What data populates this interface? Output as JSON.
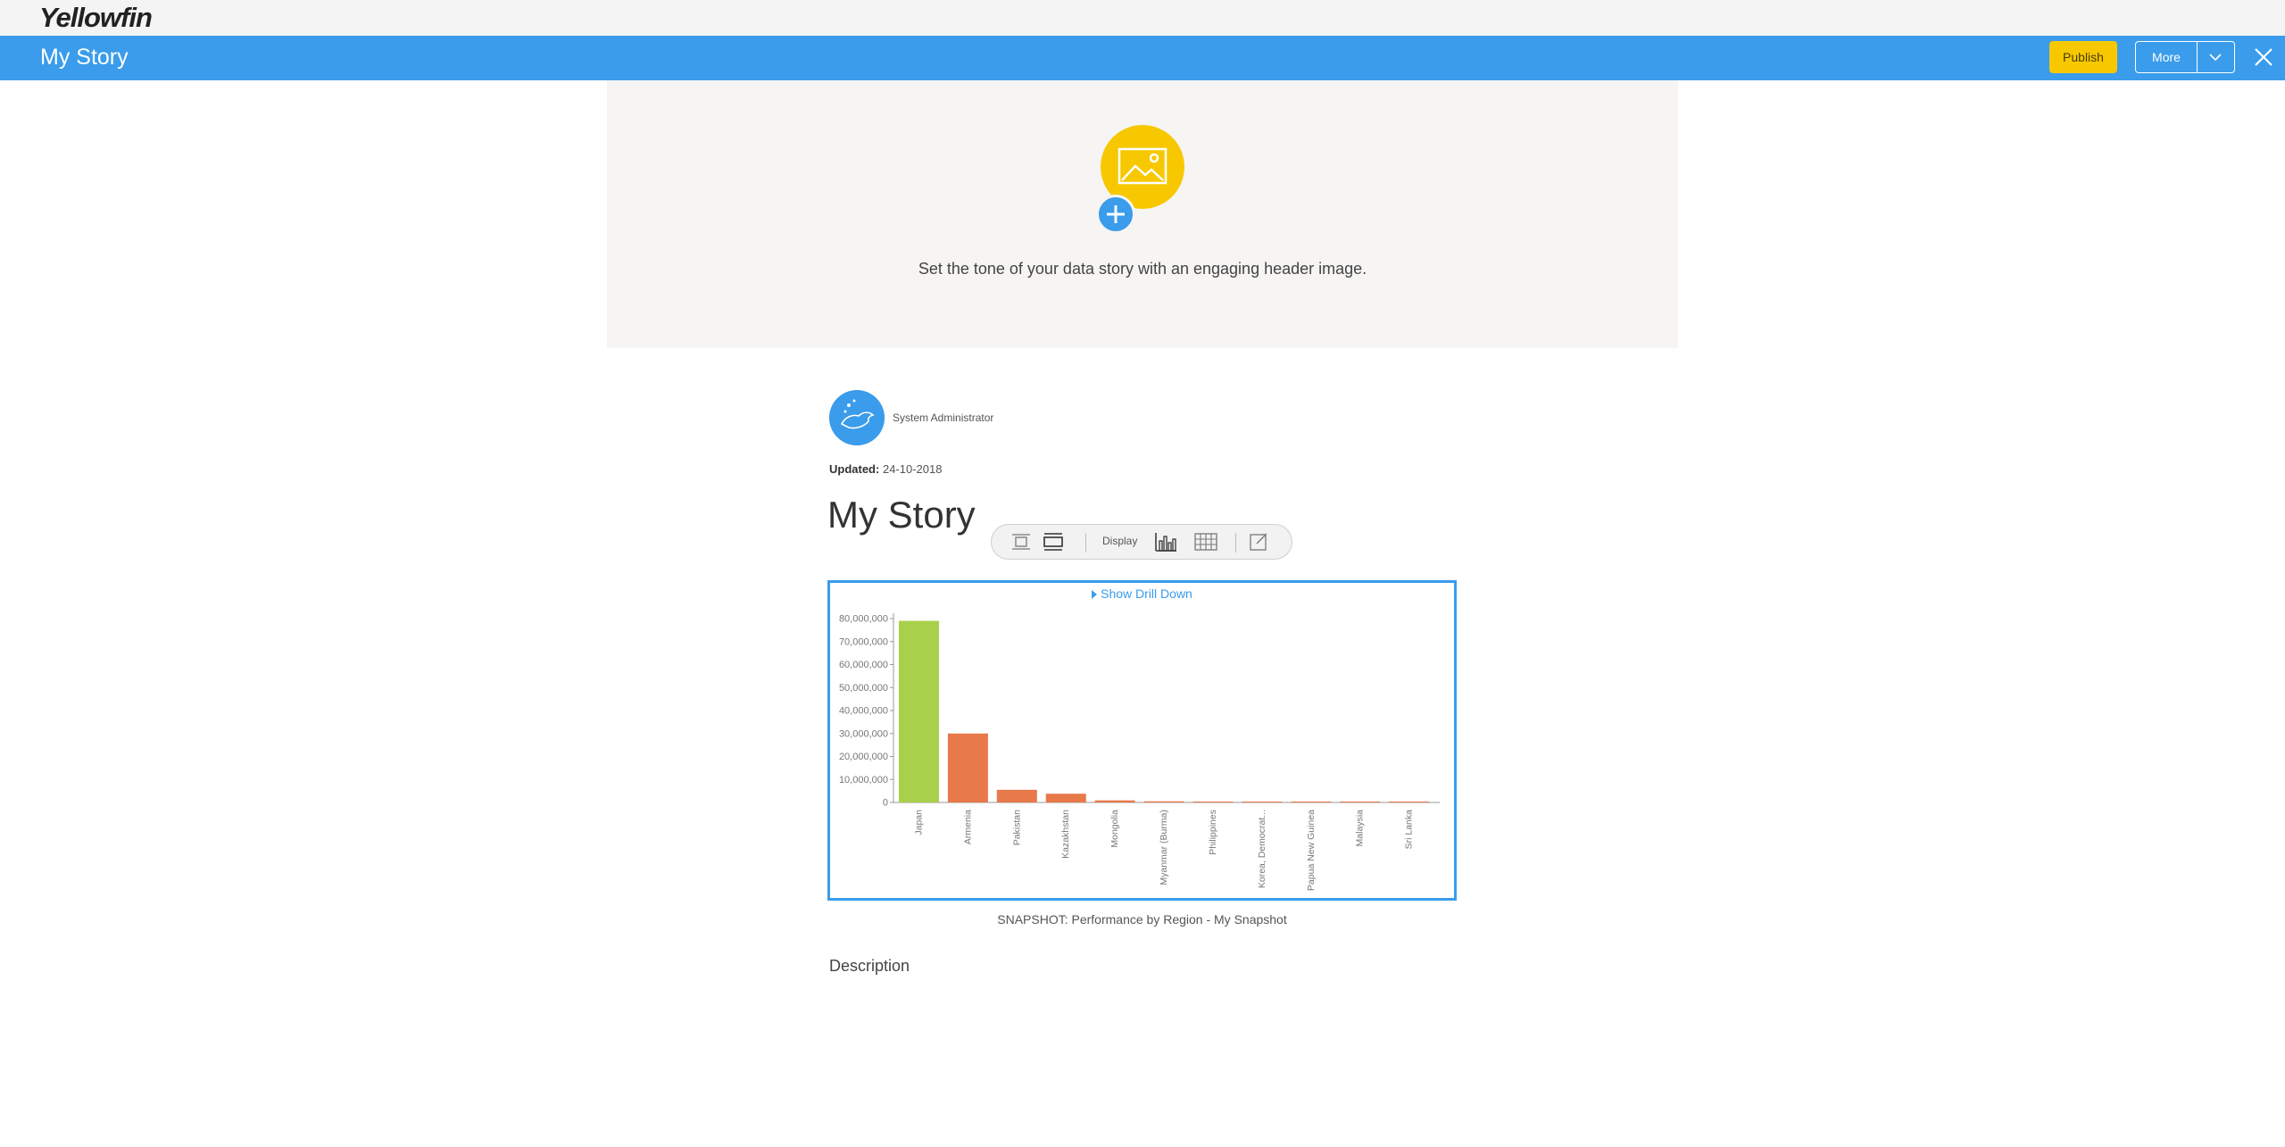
{
  "app": {
    "logo_text": "Yellowfin"
  },
  "titlebar": {
    "title": "My Story",
    "publish_label": "Publish",
    "more_label": "More",
    "more_caret_icon": "chevron-down-icon",
    "close_icon": "close-icon"
  },
  "header_image": {
    "hint": "Set the tone of your data story with an engaging header image.",
    "image_icon": "image-icon",
    "add_icon": "plus-icon"
  },
  "author": {
    "name": "System Administrator",
    "updated_label": "Updated:",
    "updated_value": "24-10-2018"
  },
  "story": {
    "title": "My Story"
  },
  "toolbar": {
    "display_label": "Display"
  },
  "report": {
    "drill_label": "Show Drill Down",
    "caption": "SNAPSHOT: Performance by Region - My Snapshot"
  },
  "colors": {
    "accent": "#3a9ceb",
    "brand_yellow": "#f7c800",
    "bar_highlight": "#a8d04a",
    "bar_default": "#e8794a"
  },
  "chart_data": {
    "type": "bar",
    "categories": [
      "Japan",
      "Armenia",
      "Pakistan",
      "Kazakhstan",
      "Mongolia",
      "Myanmar (Burma)",
      "Philippines",
      "Korea, Democrat...",
      "Papua New Guinea",
      "Malaysia",
      "Sri Lanka"
    ],
    "values": [
      79000000,
      30000000,
      5500000,
      3800000,
      900000,
      500000,
      300000,
      200000,
      150000,
      100000,
      50000
    ],
    "highlight_index": 0,
    "ylim": [
      0,
      80000000
    ],
    "yticks": [
      "0",
      "10,000,000",
      "20,000,000",
      "30,000,000",
      "40,000,000",
      "50,000,000",
      "60,000,000",
      "70,000,000",
      "80,000,000"
    ],
    "ytick_values": [
      0,
      10000000,
      20000000,
      30000000,
      40000000,
      50000000,
      60000000,
      70000000,
      80000000
    ],
    "xlabel": "",
    "ylabel": "",
    "grid": false
  },
  "description": {
    "heading": "Description"
  }
}
